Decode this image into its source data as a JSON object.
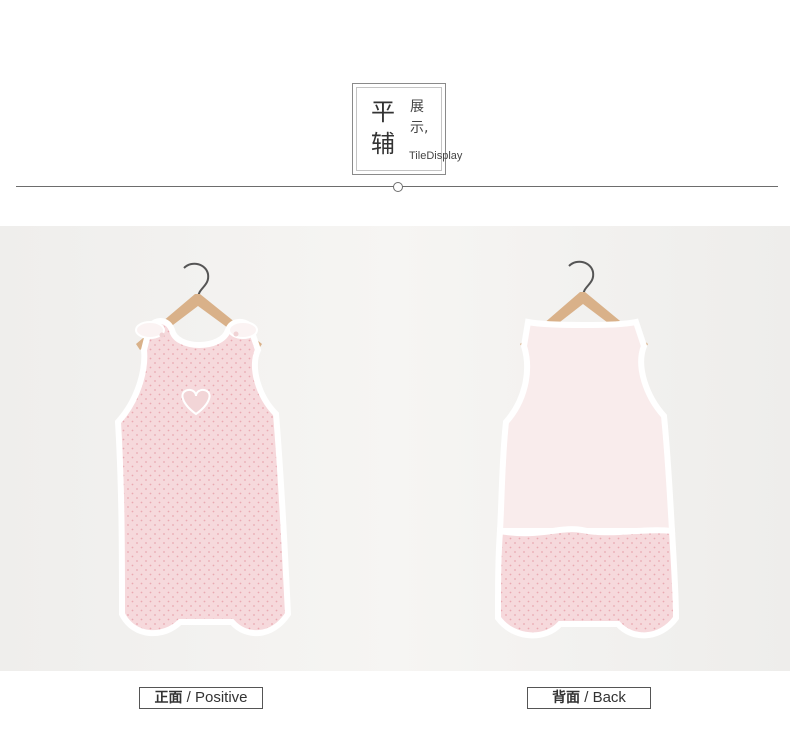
{
  "header": {
    "title_char_1": "平",
    "title_char_2": "辅",
    "subtitle_char_1": "展",
    "subtitle_char_2": "示,",
    "subtitle_en": "TileDisplay"
  },
  "captions": {
    "front_cn": "正面",
    "front_en": " / Positive",
    "back_cn": "背面",
    "back_en": " / Back"
  },
  "colors": {
    "garment_pink": "#f6d9dc",
    "dot_pink": "#e9a9b2",
    "mesh_pink": "#f9e9ea",
    "hanger_wood": "#d9b189"
  }
}
